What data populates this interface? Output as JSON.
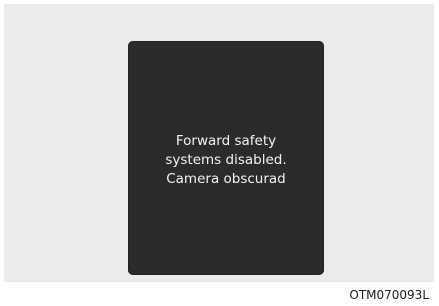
{
  "display": {
    "message_lines": [
      "Forward safety",
      "systems disabled.",
      "Camera obscurad"
    ]
  },
  "figure": {
    "id": "OTM070093L"
  },
  "colors": {
    "background": "#ebebeb",
    "display_panel": "#2b2b2b",
    "message_text": "#f2f2f2"
  }
}
